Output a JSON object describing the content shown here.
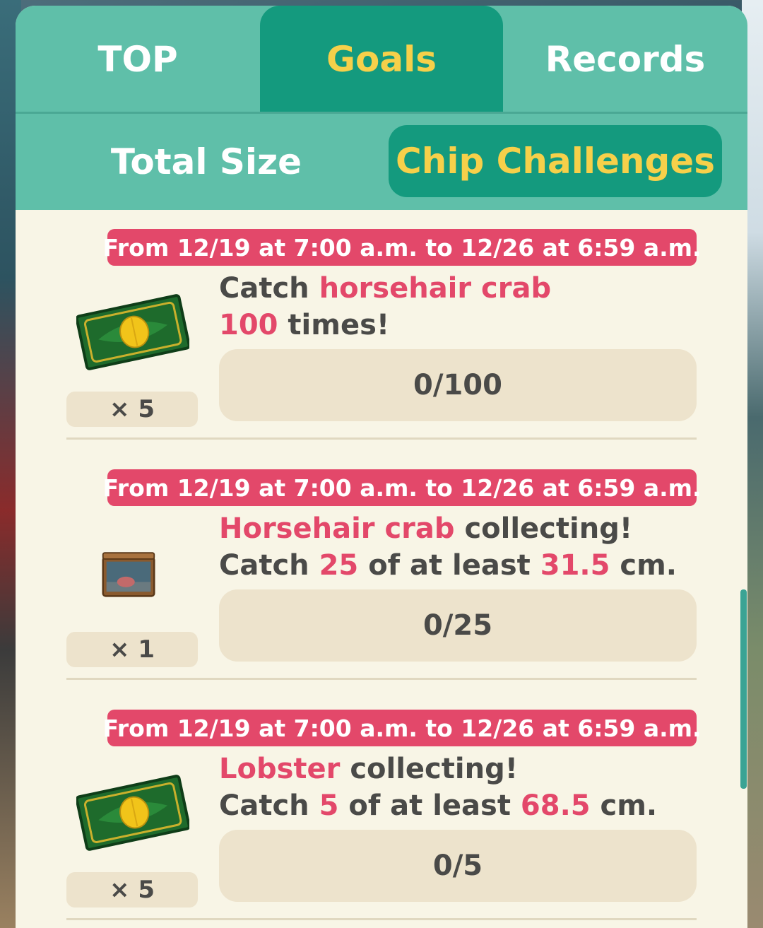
{
  "tabs": [
    "TOP",
    "Goals",
    "Records"
  ],
  "active_tab": "Goals",
  "subtabs": [
    "Total Size",
    "Chip Challenges"
  ],
  "active_subtab": "Chip Challenges",
  "colors": {
    "panel_bg": "#f8f5e6",
    "tab_bg": "#5fbfa9",
    "tab_active_bg": "#149a7e",
    "tab_active_text": "#f6d04a",
    "banner_bg": "#e3486a",
    "highlight_text": "#e3486a",
    "progress_bg": "#ede3cc",
    "body_text": "#4a4a48"
  },
  "challenges": [
    {
      "date_range": "From 12/19 at 7:00 a.m. to 12/26 at 6:59 a.m.",
      "line1": {
        "a": "Catch ",
        "b": "horsehair crab",
        "c": ""
      },
      "line2": {
        "a": "",
        "b": "100",
        "c": " times!",
        "d": "",
        "e": ""
      },
      "progress": "0/100",
      "reward_icon": "leaf-ticket-icon",
      "quantity": "× 5"
    },
    {
      "date_range": "From 12/19 at 7:00 a.m. to 12/26 at 6:59 a.m.",
      "line1": {
        "a": "",
        "b": "Horsehair crab",
        "c": " collecting!"
      },
      "line2": {
        "a": "Catch ",
        "b": "25",
        "c": " of at least ",
        "d": "31.5",
        "e": " cm."
      },
      "progress": "0/25",
      "reward_icon": "aquarium-tank-icon",
      "quantity": "× 1"
    },
    {
      "date_range": "From 12/19 at 7:00 a.m. to 12/26 at 6:59 a.m.",
      "line1": {
        "a": "",
        "b": "Lobster",
        "c": " collecting!"
      },
      "line2": {
        "a": "Catch ",
        "b": "5",
        "c": " of at least ",
        "d": "68.5",
        "e": " cm."
      },
      "progress": "0/5",
      "reward_icon": "leaf-ticket-icon",
      "quantity": "× 5"
    }
  ]
}
